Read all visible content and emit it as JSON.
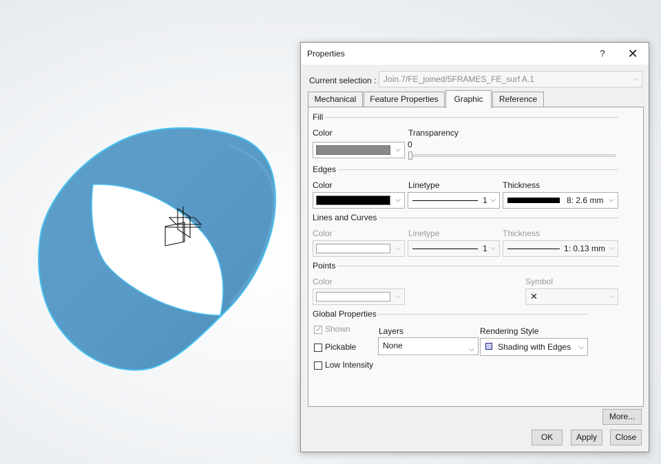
{
  "dialog": {
    "title": "Properties",
    "help_label": "?",
    "close_glyph": "✕",
    "current_selection_label": "Current selection :",
    "current_selection_value": "Join.7/FE_joined/5FRAMES_FE_surf A.1",
    "tabs": [
      {
        "label": "Mechanical",
        "active": false
      },
      {
        "label": "Feature Properties",
        "active": false
      },
      {
        "label": "Graphic",
        "active": true
      },
      {
        "label": "Reference",
        "active": false
      }
    ],
    "fill": {
      "group_label": "Fill",
      "color_label": "Color",
      "transparency_label": "Transparency",
      "transparency_value": "0",
      "swatch_color": "#888888"
    },
    "edges": {
      "group_label": "Edges",
      "color_label": "Color",
      "linetype_label": "Linetype",
      "thickness_label": "Thickness",
      "swatch_color": "#000000",
      "linetype_value": "1",
      "thickness_value": "8: 2.6 mm"
    },
    "lines_curves": {
      "group_label": "Lines and Curves",
      "color_label": "Color",
      "linetype_label": "Linetype",
      "thickness_label": "Thickness",
      "swatch_color": "#ffffff",
      "linetype_value": "1",
      "thickness_value": "1: 0.13 mm"
    },
    "points": {
      "group_label": "Points",
      "color_label": "Color",
      "symbol_label": "Symbol",
      "swatch_color": "#ffffff",
      "symbol_value": "✕"
    },
    "global": {
      "group_label": "Global Properties",
      "shown_label": "Shown",
      "shown_checked": true,
      "pickable_label": "Pickable",
      "low_intensity_label": "Low Intensity",
      "layers_label": "Layers",
      "layers_value": "None",
      "rendering_label": "Rendering Style",
      "rendering_value": "Shading with Edges"
    },
    "buttons": {
      "more": "More...",
      "ok": "OK",
      "apply": "Apply",
      "close": "Close"
    },
    "dropdown_glyph": "⌵",
    "check_glyph": "✓"
  },
  "viewport": {
    "part_color": "#5a9fcc",
    "highlight_color": "#47c1f0"
  }
}
